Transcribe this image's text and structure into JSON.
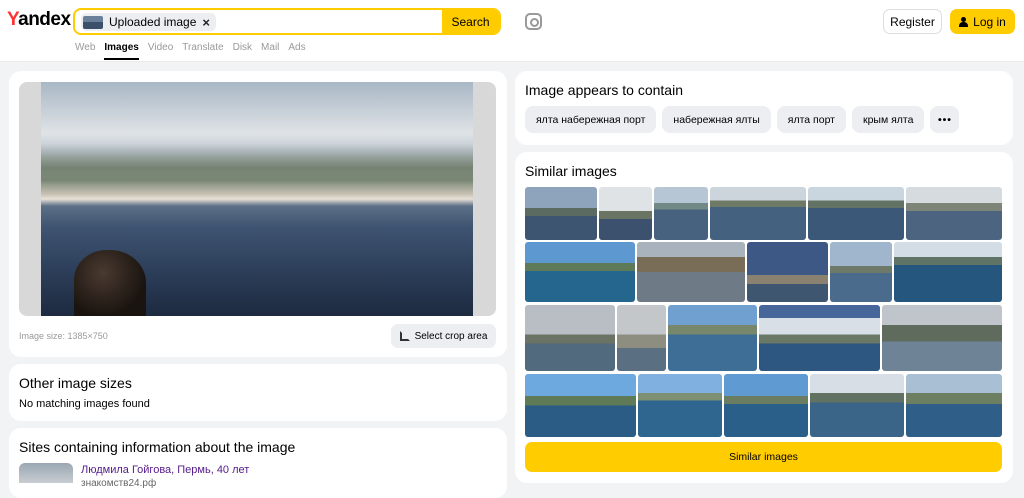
{
  "header": {
    "logo": "Yandex",
    "search_chip": "Uploaded image",
    "chip_close": "×",
    "search_button": "Search",
    "register": "Register",
    "login": "Log in",
    "tabs": [
      "Web",
      "Images",
      "Video",
      "Translate",
      "Disk",
      "Mail",
      "Ads"
    ],
    "active_tab": "Images"
  },
  "image_panel": {
    "size_label": "Image size: 1385×750",
    "crop_button": "Select crop area"
  },
  "contains": {
    "title": "Image appears to contain",
    "tags": [
      "ялта набережная порт",
      "набережная ялты",
      "ялта порт",
      "крым ялта"
    ],
    "more": "•••"
  },
  "other_sizes": {
    "title": "Other image sizes",
    "message": "No matching images found"
  },
  "sites": {
    "title": "Sites containing information about the image",
    "first_title": "Людмила Гойгова, Пермь, 40 лет",
    "first_domain": "знакомств24.рф"
  },
  "similar": {
    "title": "Similar images",
    "button": "Similar images"
  }
}
